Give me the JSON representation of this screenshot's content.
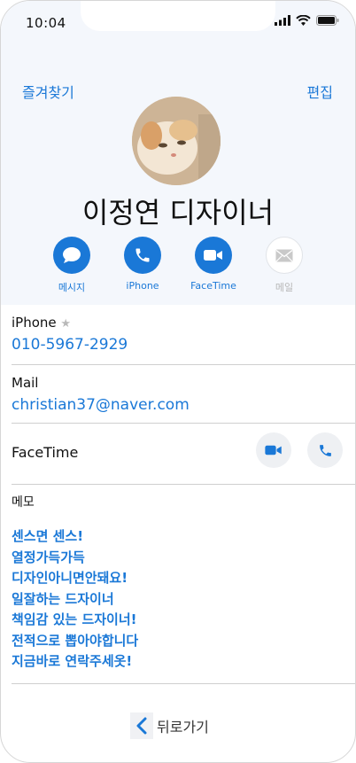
{
  "status_bar": {
    "time": "10:04"
  },
  "nav": {
    "favorites_label": "즐겨찾기",
    "edit_label": "편집"
  },
  "contact": {
    "name": "이정연 디자이너"
  },
  "actions": {
    "message_label": "메시지",
    "phone_label": "iPhone",
    "facetime_label": "FaceTime",
    "mail_label": "메일"
  },
  "phone_row": {
    "label": "iPhone",
    "star": "★",
    "value": "010-5967-2929"
  },
  "mail_row": {
    "label": "Mail",
    "value": "christian37@naver.com"
  },
  "facetime_row": {
    "label": "FaceTime"
  },
  "memo": {
    "label": "메모",
    "lines": [
      "센스면 센스!",
      "열정가득가득",
      "디자인아니면안돼요!",
      "일잘하는 드자이너",
      "책임감 있는 드자이너!",
      "전적으로 뽑아야합니다",
      "지금바로 연락주세옷!"
    ]
  },
  "back": {
    "label": "뒤로가기"
  },
  "colors": {
    "accent": "#1a78d7",
    "header_bg": "#f4f7fc",
    "divider": "#cfcfcf"
  }
}
